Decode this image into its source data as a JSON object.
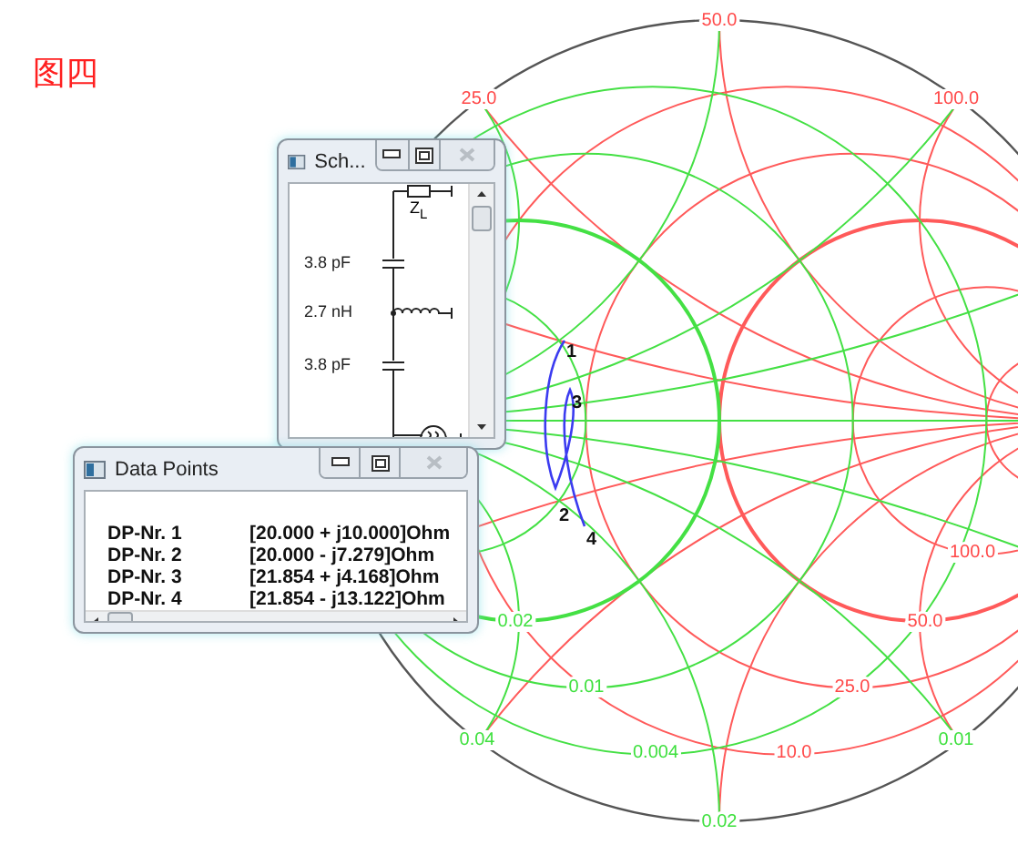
{
  "caption": "图四",
  "chart": {
    "labels": [
      {
        "text": "50.0",
        "color": "#ff4848"
      },
      {
        "text": "25.0",
        "color": "#ff4848"
      },
      {
        "text": "100.0",
        "color": "#ff4848"
      },
      {
        "text": "100.0",
        "color": "#ff4848"
      },
      {
        "text": "50.0",
        "color": "#ff4848"
      },
      {
        "text": "25.0",
        "color": "#ff4848"
      },
      {
        "text": "10.0",
        "color": "#ff4848"
      },
      {
        "text": "0.02",
        "color": "#3ee03e"
      },
      {
        "text": "0.01",
        "color": "#3ee03e"
      },
      {
        "text": "0.04",
        "color": "#3ee03e"
      },
      {
        "text": "0.004",
        "color": "#3ee03e"
      },
      {
        "text": "0.01",
        "color": "#3ee03e"
      },
      {
        "text": "0.02",
        "color": "#3ee03e"
      }
    ],
    "points": [
      "1",
      "2",
      "3",
      "4"
    ]
  },
  "schematic_window": {
    "title": "Sch...",
    "load_label": "Z$_{L}$",
    "components": [
      {
        "kind": "capacitor",
        "value": "3.8 pF"
      },
      {
        "kind": "inductor",
        "value": "2.7 nH"
      },
      {
        "kind": "capacitor",
        "value": "3.8 pF"
      }
    ]
  },
  "data_window": {
    "title": "Data Points",
    "rows": [
      {
        "label": "DP-Nr. 1",
        "value": "[20.000 + j10.000]Ohm"
      },
      {
        "label": "DP-Nr. 2",
        "value": "[20.000 - j7.279]Ohm"
      },
      {
        "label": "DP-Nr. 3",
        "value": "[21.854 + j4.168]Ohm"
      },
      {
        "label": "DP-Nr. 4",
        "value": "[21.854 - j13.122]Ohm"
      }
    ]
  }
}
